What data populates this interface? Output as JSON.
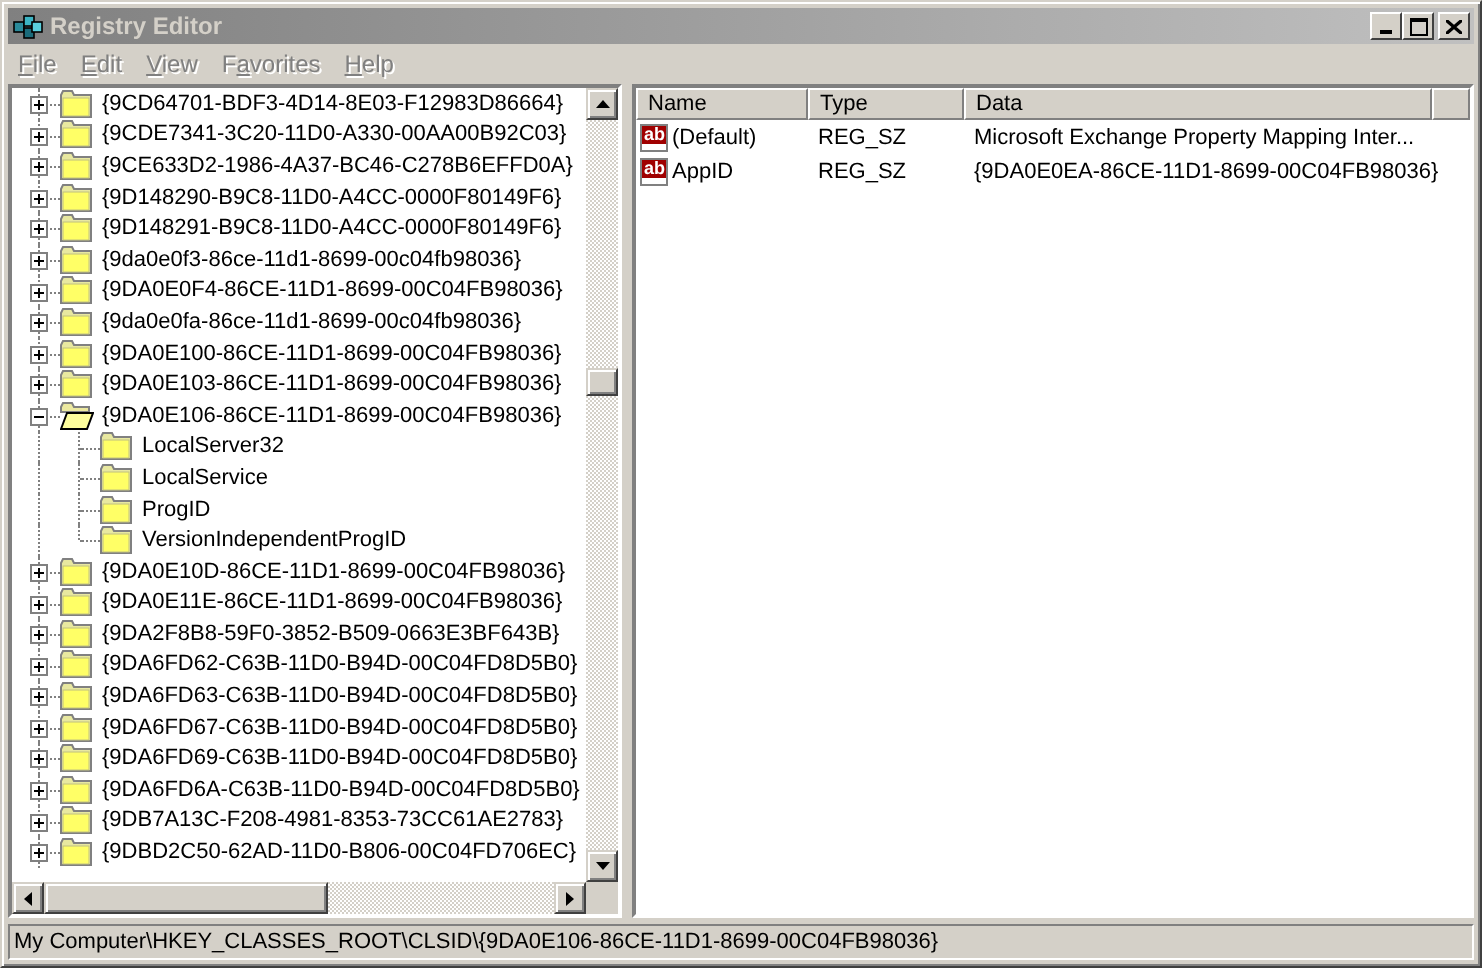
{
  "window": {
    "title": "Registry Editor"
  },
  "menu": [
    {
      "key": "F",
      "after": "ile"
    },
    {
      "key": "E",
      "after": "dit"
    },
    {
      "key": "V",
      "after": "iew"
    },
    {
      "before": "F",
      "key": "a",
      "after": "vorites"
    },
    {
      "key": "H",
      "after": "elp"
    }
  ],
  "tree": [
    {
      "label": "{9CD64701-BDF3-4D14-8E03-F12983D86664}",
      "expanded": false
    },
    {
      "label": "{9CDE7341-3C20-11D0-A330-00AA00B92C03}",
      "expanded": false
    },
    {
      "label": "{9CE633D2-1986-4A37-BC46-C278B6EFFD0A}",
      "expanded": false
    },
    {
      "label": "{9D148290-B9C8-11D0-A4CC-0000F80149F6}",
      "expanded": false
    },
    {
      "label": "{9D148291-B9C8-11D0-A4CC-0000F80149F6}",
      "expanded": false
    },
    {
      "label": "{9da0e0f3-86ce-11d1-8699-00c04fb98036}",
      "expanded": false
    },
    {
      "label": "{9DA0E0F4-86CE-11D1-8699-00C04FB98036}",
      "expanded": false
    },
    {
      "label": "{9da0e0fa-86ce-11d1-8699-00c04fb98036}",
      "expanded": false
    },
    {
      "label": "{9DA0E100-86CE-11D1-8699-00C04FB98036}",
      "expanded": false
    },
    {
      "label": "{9DA0E103-86CE-11D1-8699-00C04FB98036}",
      "expanded": false
    },
    {
      "label": "{9DA0E106-86CE-11D1-8699-00C04FB98036}",
      "expanded": true,
      "children": [
        {
          "label": "LocalServer32"
        },
        {
          "label": "LocalService"
        },
        {
          "label": "ProgID"
        },
        {
          "label": "VersionIndependentProgID"
        }
      ]
    },
    {
      "label": "{9DA0E10D-86CE-11D1-8699-00C04FB98036}",
      "expanded": false
    },
    {
      "label": "{9DA0E11E-86CE-11D1-8699-00C04FB98036}",
      "expanded": false
    },
    {
      "label": "{9DA2F8B8-59F0-3852-B509-0663E3BF643B}",
      "expanded": false
    },
    {
      "label": "{9DA6FD62-C63B-11D0-B94D-00C04FD8D5B0}",
      "expanded": false
    },
    {
      "label": "{9DA6FD63-C63B-11D0-B94D-00C04FD8D5B0}",
      "expanded": false
    },
    {
      "label": "{9DA6FD67-C63B-11D0-B94D-00C04FD8D5B0}",
      "expanded": false
    },
    {
      "label": "{9DA6FD69-C63B-11D0-B94D-00C04FD8D5B0}",
      "expanded": false
    },
    {
      "label": "{9DA6FD6A-C63B-11D0-B94D-00C04FD8D5B0}",
      "expanded": false
    },
    {
      "label": "{9DB7A13C-F208-4981-8353-73CC61AE2783}",
      "expanded": false
    },
    {
      "label": "{9DBD2C50-62AD-11D0-B806-00C04FD706EC}",
      "expanded": false
    }
  ],
  "values": {
    "columns": [
      "Name",
      "Type",
      "Data"
    ],
    "rows": [
      {
        "badge": "ab",
        "name": "(Default)",
        "type": "REG_SZ",
        "data": "Microsoft Exchange Property Mapping Inter..."
      },
      {
        "badge": "ab",
        "name": "AppID",
        "type": "REG_SZ",
        "data": "{9DA0E0EA-86CE-11D1-8699-00C04FB98036}"
      }
    ]
  },
  "status_bar": "My Computer\\HKEY_CLASSES_ROOT\\CLSID\\{9DA0E106-86CE-11D1-8699-00C04FB98036}"
}
